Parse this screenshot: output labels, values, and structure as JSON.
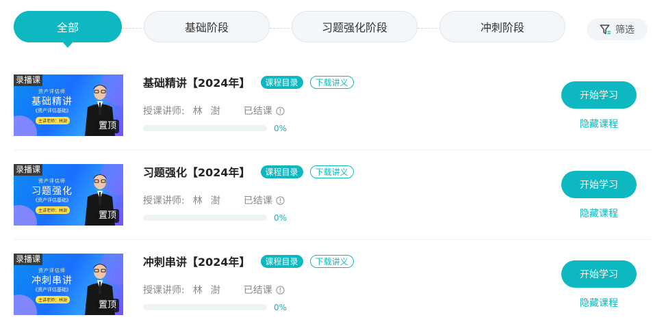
{
  "tabs": [
    {
      "label": "全部",
      "active": true
    },
    {
      "label": "基础阶段",
      "active": false
    },
    {
      "label": "习题强化阶段",
      "active": false
    },
    {
      "label": "冲刺阶段",
      "active": false
    }
  ],
  "filter": {
    "label": "筛选",
    "icon": "filter-icon"
  },
  "colors": {
    "accent": "#0db8c0",
    "tab_bg": "#f4f7f9"
  },
  "courses": [
    {
      "cover": {
        "badge": "录播课",
        "brand": "资产评估师",
        "title": "基础精讲",
        "subtitle": "《资产评估基础》",
        "teacher_tag": "主讲老师：林澍",
        "pin": "置顶"
      },
      "title": "基础精讲【2024年】",
      "catalog_label": "课程目录",
      "handout_label": "下载讲义",
      "teacher_label": "授课讲师:",
      "teacher_name": "林澍",
      "status": "已结课",
      "progress": 0,
      "progress_text": "0%",
      "start_label": "开始学习",
      "hide_label": "隐藏课程"
    },
    {
      "cover": {
        "badge": "录播课",
        "brand": "资产评估师",
        "title": "习题强化",
        "subtitle": "《资产评估基础》",
        "teacher_tag": "主讲老师：林澍",
        "pin": "置顶"
      },
      "title": "习题强化【2024年】",
      "catalog_label": "课程目录",
      "handout_label": "下载讲义",
      "teacher_label": "授课讲师:",
      "teacher_name": "林澍",
      "status": "已结课",
      "progress": 0,
      "progress_text": "0%",
      "start_label": "开始学习",
      "hide_label": "隐藏课程"
    },
    {
      "cover": {
        "badge": "录播课",
        "brand": "资产评估师",
        "title": "冲刺串讲",
        "subtitle": "《资产评估基础》",
        "teacher_tag": "主讲老师：林澍",
        "pin": "置顶"
      },
      "title": "冲刺串讲【2024年】",
      "catalog_label": "课程目录",
      "handout_label": "下载讲义",
      "teacher_label": "授课讲师:",
      "teacher_name": "林澍",
      "status": "已结课",
      "progress": 0,
      "progress_text": "0%",
      "start_label": "开始学习",
      "hide_label": "隐藏课程"
    }
  ]
}
